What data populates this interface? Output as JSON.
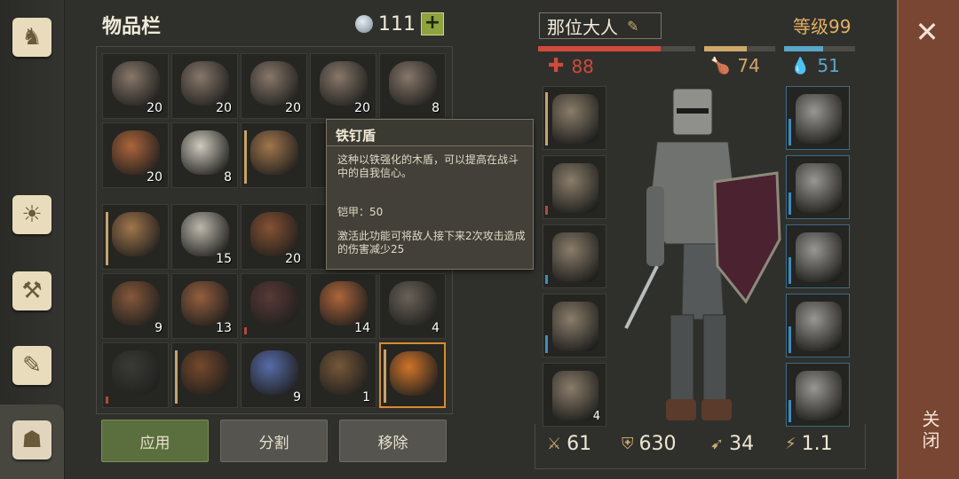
{
  "inventory": {
    "title": "物品栏",
    "currency_value": "111",
    "plus_label": "+",
    "slots": [
      {
        "icon": "ore-icon",
        "qty": "20",
        "color": "#8c7b6d"
      },
      {
        "icon": "ore-icon",
        "qty": "20",
        "color": "#8c7b6d"
      },
      {
        "icon": "ore-icon",
        "qty": "20",
        "color": "#8c7b6d"
      },
      {
        "icon": "ore-icon",
        "qty": "20",
        "color": "#8c7b6d"
      },
      {
        "icon": "ore-icon",
        "qty": "8",
        "color": "#8c7b6d"
      },
      {
        "icon": "mushroom-icon",
        "qty": "20",
        "color": "#b4683c"
      },
      {
        "icon": "cloth-roll-icon",
        "qty": "8",
        "color": "#d8d3c6"
      },
      {
        "icon": "pickaxe-icon",
        "qty": "",
        "color": "#a87a4e"
      },
      {
        "icon": "",
        "qty": "",
        "color": ""
      },
      {
        "icon": "",
        "qty": "",
        "color": ""
      },
      {
        "icon": "pickaxe-icon",
        "qty": "",
        "color": "#a87a4e"
      },
      {
        "icon": "mushroom-icon",
        "qty": "15",
        "color": "#c4bfb3"
      },
      {
        "icon": "leather-icon",
        "qty": "20",
        "color": "#8b5333"
      },
      {
        "icon": "",
        "qty": "",
        "color": ""
      },
      {
        "icon": "",
        "qty": "",
        "color": ""
      },
      {
        "icon": "nails-icon",
        "qty": "9",
        "color": "#8a5a3c"
      },
      {
        "icon": "leather-icon",
        "qty": "13",
        "color": "#9a6140"
      },
      {
        "icon": "leg-armor-icon",
        "qty": "",
        "color": "#5a3a38"
      },
      {
        "icon": "mushroom-icon",
        "qty": "14",
        "color": "#b4683c"
      },
      {
        "icon": "shoulder-plate-icon",
        "qty": "4",
        "color": "#6e655c"
      },
      {
        "icon": "boots-icon",
        "qty": "",
        "color": "#3b3b38"
      },
      {
        "icon": "crossbow-icon",
        "qty": "",
        "color": "#7a4a2c"
      },
      {
        "icon": "crystal-icon",
        "qty": "9",
        "color": "#5a6fb0"
      },
      {
        "icon": "rope-icon",
        "qty": "1",
        "color": "#7a5a3a"
      },
      {
        "icon": "fire-sword-icon",
        "qty": "",
        "color": "#d9782a"
      }
    ]
  },
  "tooltip": {
    "title": "铁钉盾",
    "description": "这种以铁强化的木盾，可以提高在战斗中的自我信心。",
    "armor": "铠甲：50",
    "effect": "激活此功能可将敌人接下来2次攻击造成的伤害减少25"
  },
  "buttons": {
    "apply": "应用",
    "split": "分割",
    "remove": "移除"
  },
  "character": {
    "name": "那位大人",
    "level": "等级99",
    "health": "88",
    "food": "74",
    "water": "51",
    "health_fraction": 0.78,
    "food_fraction": 0.6,
    "water_fraction": 0.55,
    "colors": {
      "health": "#d04a3c",
      "food": "#d0a86a",
      "water": "#5aa6c8",
      "level": "#e3b062"
    }
  },
  "equipment": {
    "left": [
      {
        "icon": "sword-icon"
      },
      {
        "icon": "shield-icon"
      },
      {
        "icon": "backpack-icon"
      },
      {
        "icon": "sword-icon"
      },
      {
        "icon": "soup-bowl-icon",
        "qty": "4"
      }
    ],
    "right": [
      {
        "icon": "helmet-icon"
      },
      {
        "icon": "chest-armor-icon"
      },
      {
        "icon": "gauntlets-icon"
      },
      {
        "icon": "leg-armor-icon"
      },
      {
        "icon": "boots-icon"
      }
    ]
  },
  "bottom_stats": {
    "attack": "61",
    "armor": "630",
    "speed": "34",
    "attack_speed": "1.1"
  },
  "close": {
    "x_label": "✕",
    "label": "关闭"
  }
}
